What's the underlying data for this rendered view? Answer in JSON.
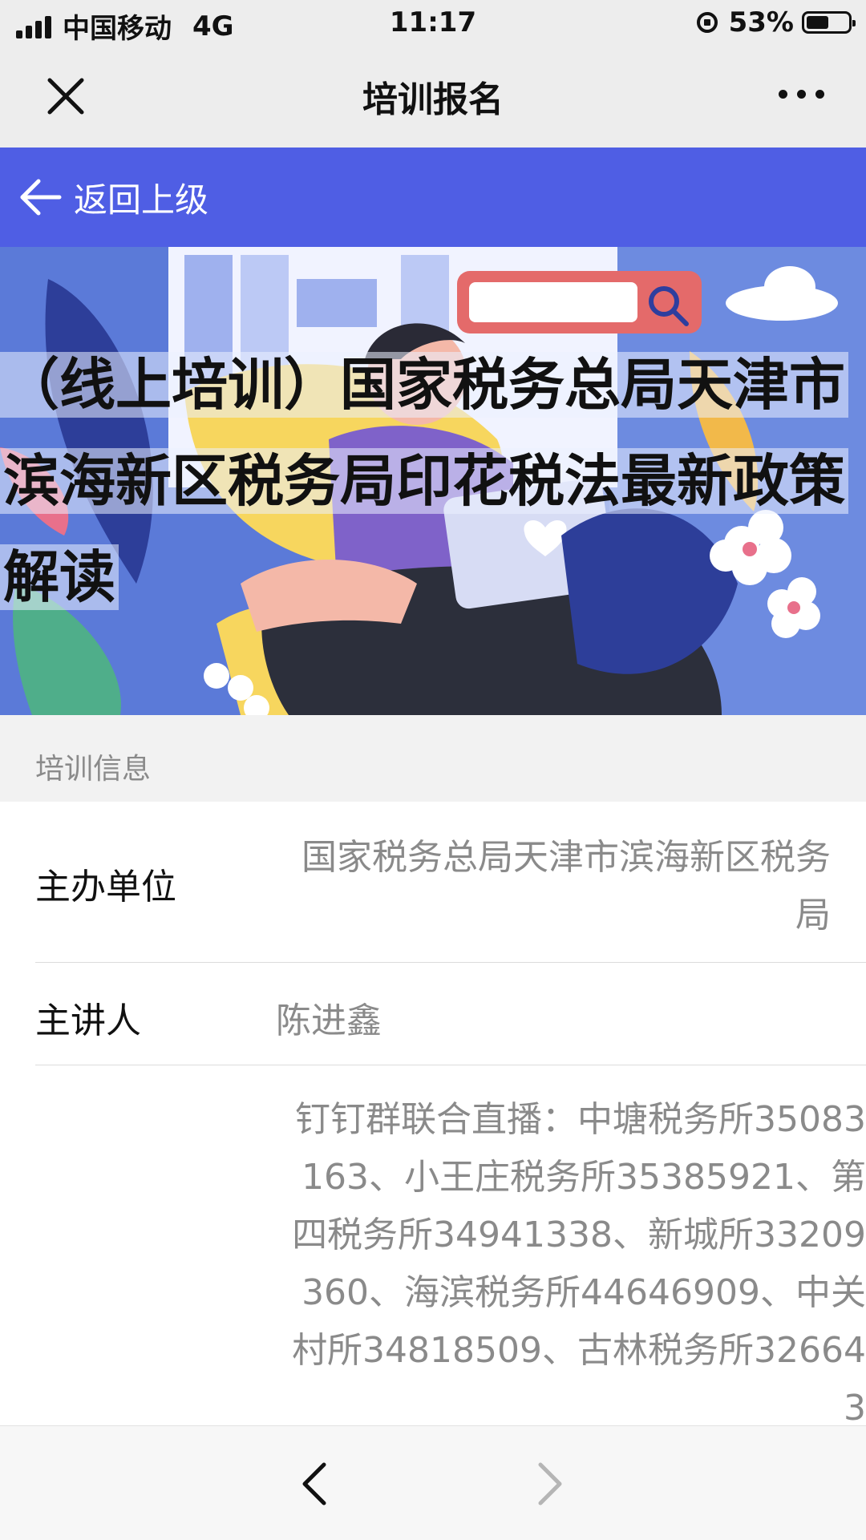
{
  "status_bar": {
    "carrier": "中国移动",
    "network": "4G",
    "time": "11:17",
    "battery": "53%",
    "battery_level": 0.53,
    "icons": [
      "signal-icon",
      "orientation-lock-icon",
      "battery-icon"
    ]
  },
  "navbar": {
    "title": "培训报名",
    "icons": [
      "close-icon",
      "more-icon"
    ]
  },
  "back_bar": {
    "label": "返回上级",
    "icon": "arrow-left-icon",
    "background": "#4f5ee4"
  },
  "banner": {
    "title": "（线上培训）国家税务总局天津市滨海新区税务局印花税法最新政策解读"
  },
  "section": {
    "label": "培训信息"
  },
  "info": {
    "host_label": "主办单位",
    "host_value": "国家税务总局天津市滨海新区税务局",
    "speaker_label": "主讲人",
    "speaker_value": "陈进鑫",
    "live_value": "钉钉群联合直播：中塘税务所35083163、小王庄税务所35385921、第四税务所34941338、新城所33209360、海滨税务所44646909、中关村所34818509、古林税务所326643"
  },
  "bottom_bar": {
    "icons": [
      "chevron-left-icon",
      "chevron-right-icon"
    ]
  }
}
